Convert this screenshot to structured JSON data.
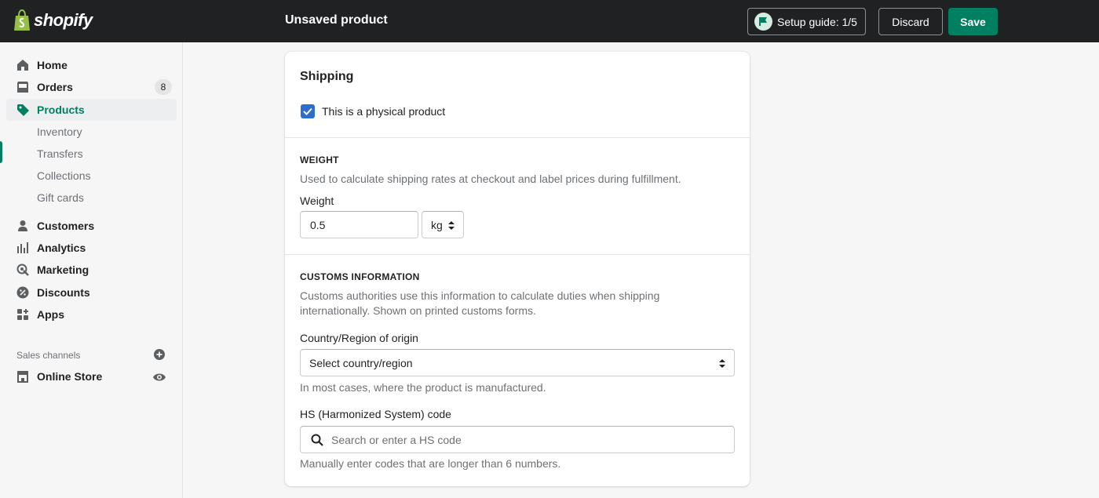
{
  "topbar": {
    "brand": "shopify",
    "title": "Unsaved product",
    "setup_guide_label": "Setup guide: 1/5",
    "discard_label": "Discard",
    "save_label": "Save"
  },
  "sidebar": {
    "items": [
      {
        "label": "Home",
        "icon": "home-icon"
      },
      {
        "label": "Orders",
        "icon": "orders-icon",
        "badge": "8"
      },
      {
        "label": "Products",
        "icon": "tag-icon",
        "active": true
      },
      {
        "label": "Customers",
        "icon": "person-icon"
      },
      {
        "label": "Analytics",
        "icon": "bar-chart-icon"
      },
      {
        "label": "Marketing",
        "icon": "marketing-icon"
      },
      {
        "label": "Discounts",
        "icon": "discount-icon"
      },
      {
        "label": "Apps",
        "icon": "apps-icon"
      }
    ],
    "products_sub": [
      "Inventory",
      "Transfers",
      "Collections",
      "Gift cards"
    ],
    "channels_title": "Sales channels",
    "online_store": "Online Store"
  },
  "shipping": {
    "title": "Shipping",
    "physical_label": "This is a physical product",
    "physical_checked": true,
    "weight_heading": "WEIGHT",
    "weight_help": "Used to calculate shipping rates at checkout and label prices during fulfillment.",
    "weight_label": "Weight",
    "weight_value": "0.5",
    "weight_unit": "kg",
    "customs_heading": "CUSTOMS INFORMATION",
    "customs_help_1": "Customs authorities use this information to calculate duties when shipping",
    "customs_help_2": "internationally. Shown on printed customs forms.",
    "country_label": "Country/Region of origin",
    "country_value": "Select country/region",
    "country_help": "In most cases, where the product is manufactured.",
    "hs_label": "HS (Harmonized System) code",
    "hs_placeholder": "Search or enter a HS code",
    "hs_help": "Manually enter codes that are longer than 6 numbers."
  },
  "colors": {
    "topbar": "#202123",
    "primary": "#008060",
    "checkbox": "#2c6ecb",
    "active_text": "#007f5f"
  }
}
